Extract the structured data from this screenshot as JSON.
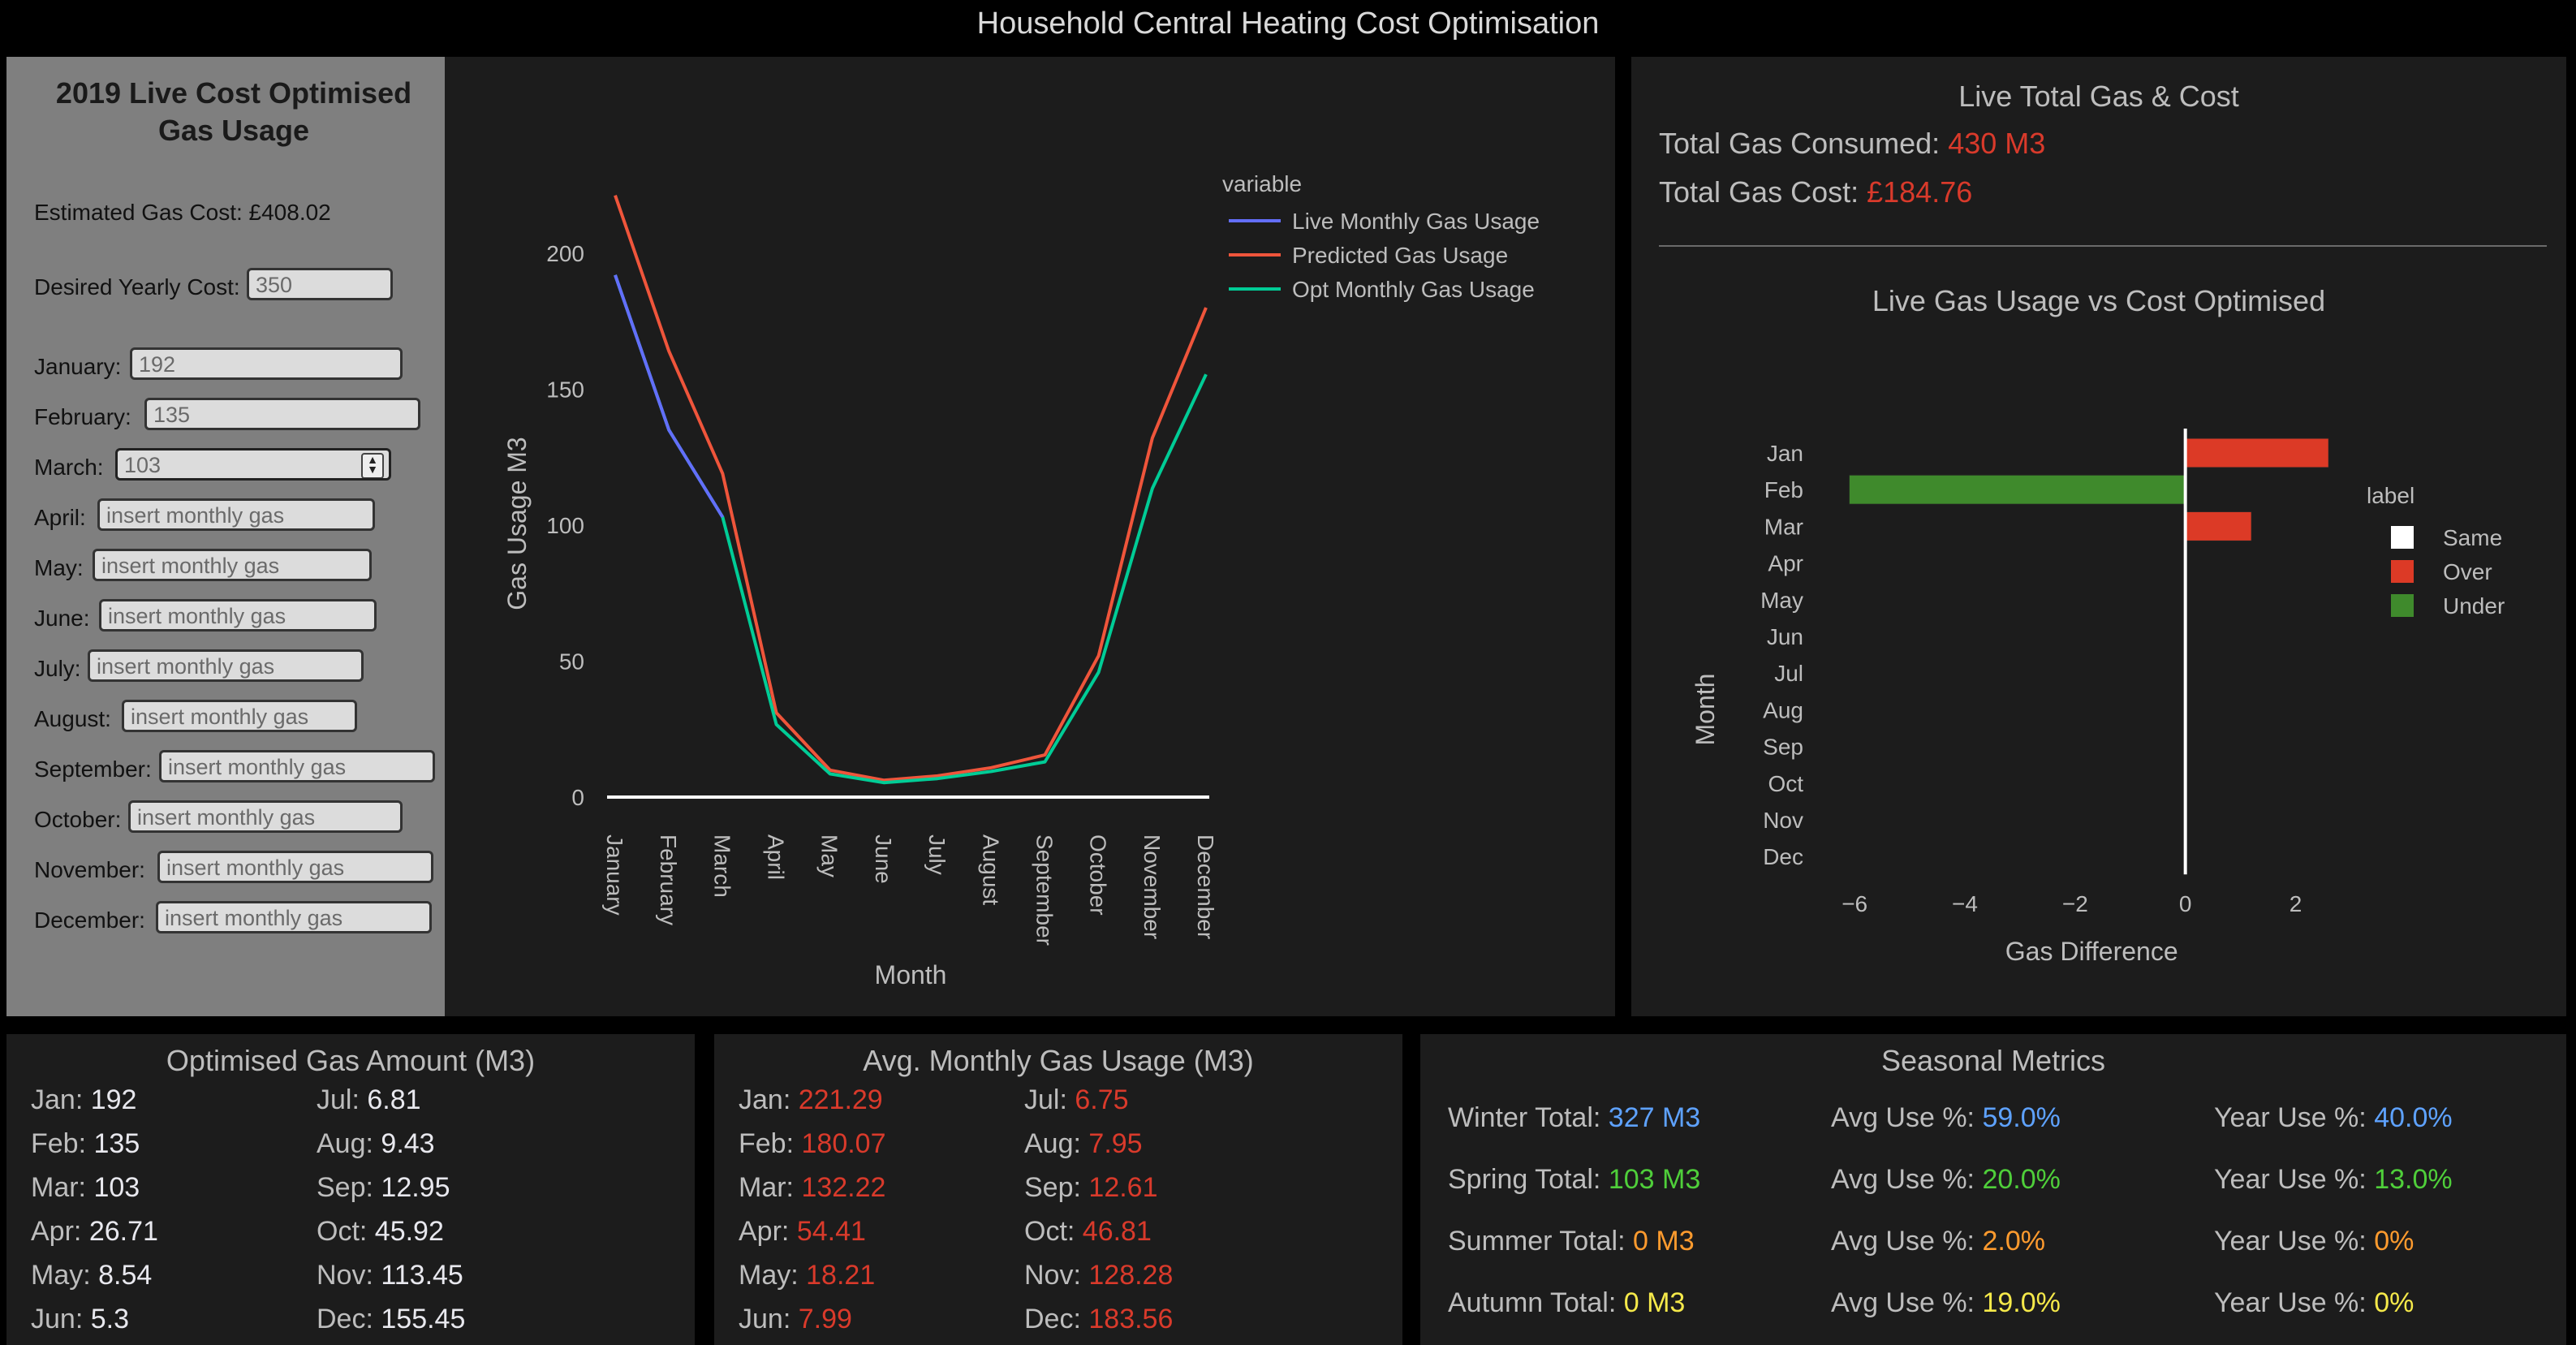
{
  "header": {
    "title": "Household Central Heating Cost Optimisation"
  },
  "sidebar": {
    "title": "2019 Live Cost Optimised Gas Usage",
    "estimated_cost": "Estimated Gas Cost: £408.02",
    "desired_label": "Desired Yearly Cost:",
    "desired_value": "350",
    "months": [
      {
        "label": "January:",
        "value": "192",
        "placeholder": ""
      },
      {
        "label": "February:",
        "value": "135",
        "placeholder": ""
      },
      {
        "label": "March:",
        "value": "103",
        "placeholder": ""
      },
      {
        "label": "April:",
        "value": "",
        "placeholder": "insert monthly gas"
      },
      {
        "label": "May:",
        "value": "",
        "placeholder": "insert monthly gas"
      },
      {
        "label": "June:",
        "value": "",
        "placeholder": "insert monthly gas"
      },
      {
        "label": "July:",
        "value": "",
        "placeholder": "insert monthly gas"
      },
      {
        "label": "August:",
        "value": "",
        "placeholder": "insert monthly gas"
      },
      {
        "label": "September:",
        "value": "",
        "placeholder": "insert monthly gas"
      },
      {
        "label": "October:",
        "value": "",
        "placeholder": "insert monthly gas"
      },
      {
        "label": "November:",
        "value": "",
        "placeholder": "insert monthly gas"
      },
      {
        "label": "December:",
        "value": "",
        "placeholder": "insert monthly gas"
      }
    ]
  },
  "totals": {
    "title": "Live Total Gas & Cost",
    "gas_label": "Total Gas Consumed:",
    "gas_value": "430 M3",
    "cost_label": "Total Gas Cost:",
    "cost_value": "£184.76"
  },
  "chart_data": [
    {
      "type": "line",
      "xlabel": "Month",
      "ylabel": "Gas Usage M3",
      "legend_title": "variable",
      "legend_position": "top-right",
      "ylim": [
        0,
        225
      ],
      "yticks": [
        0,
        50,
        100,
        150,
        200
      ],
      "categories": [
        "January",
        "February",
        "March",
        "April",
        "May",
        "June",
        "July",
        "August",
        "September",
        "October",
        "November",
        "December"
      ],
      "series": [
        {
          "name": "Live Monthly Gas Usage",
          "color": "#636efa",
          "values": [
            192,
            135,
            103
          ]
        },
        {
          "name": "Predicted Gas Usage",
          "color": "#ef553b",
          "values": [
            221.29,
            164,
            119,
            31,
            9.9,
            6.2,
            7.8,
            10.8,
            15.5,
            52,
            132,
            180
          ]
        },
        {
          "name": "Opt Monthly Gas Usage",
          "color": "#00cc96",
          "values": [
            192,
            135,
            103,
            26.71,
            8.54,
            5.3,
            6.81,
            9.43,
            12.95,
            45.92,
            113.45,
            155.45
          ]
        }
      ]
    },
    {
      "type": "bar",
      "orientation": "horizontal",
      "title": "Live Gas Usage vs Cost Optimised",
      "xlabel": "Gas Difference",
      "ylabel": "Month",
      "legend_title": "label",
      "legend_position": "right",
      "xlim": [
        -6.4,
        3.2
      ],
      "xticks": [
        -6,
        -4,
        -2,
        0,
        2
      ],
      "categories": [
        "Jan",
        "Feb",
        "Mar",
        "Apr",
        "May",
        "Jun",
        "Jul",
        "Aug",
        "Sep",
        "Oct",
        "Nov",
        "Dec"
      ],
      "values": [
        2.6,
        -6.1,
        1.2,
        0,
        0,
        0,
        0,
        0,
        0,
        0,
        0,
        0
      ],
      "labels": [
        "Over",
        "Under",
        "Over",
        "Same",
        "Same",
        "Same",
        "Same",
        "Same",
        "Same",
        "Same",
        "Same",
        "Same"
      ],
      "legend": [
        {
          "name": "Same",
          "color": "#ffffff"
        },
        {
          "name": "Over",
          "color": "#dc3a26"
        },
        {
          "name": "Under",
          "color": "#3f8a2c"
        }
      ]
    }
  ],
  "optimised": {
    "title": "Optimised Gas Amount (M3)",
    "items": [
      {
        "k": "Jan:",
        "v": "192"
      },
      {
        "k": "Feb:",
        "v": "135"
      },
      {
        "k": "Mar:",
        "v": "103"
      },
      {
        "k": "Apr:",
        "v": "26.71"
      },
      {
        "k": "May:",
        "v": "8.54"
      },
      {
        "k": "Jun:",
        "v": "5.3"
      },
      {
        "k": "Jul:",
        "v": "6.81"
      },
      {
        "k": "Aug:",
        "v": "9.43"
      },
      {
        "k": "Sep:",
        "v": "12.95"
      },
      {
        "k": "Oct:",
        "v": "45.92"
      },
      {
        "k": "Nov:",
        "v": "113.45"
      },
      {
        "k": "Dec:",
        "v": "155.45"
      }
    ]
  },
  "average": {
    "title": "Avg. Monthly Gas Usage (M3)",
    "items": [
      {
        "k": "Jan:",
        "v": "221.29"
      },
      {
        "k": "Feb:",
        "v": "180.07"
      },
      {
        "k": "Mar:",
        "v": "132.22"
      },
      {
        "k": "Apr:",
        "v": "54.41"
      },
      {
        "k": "May:",
        "v": "18.21"
      },
      {
        "k": "Jun:",
        "v": "7.99"
      },
      {
        "k": "Jul:",
        "v": "6.75"
      },
      {
        "k": "Aug:",
        "v": "7.95"
      },
      {
        "k": "Sep:",
        "v": "12.61"
      },
      {
        "k": "Oct:",
        "v": "46.81"
      },
      {
        "k": "Nov:",
        "v": "128.28"
      },
      {
        "k": "Dec:",
        "v": "183.56"
      }
    ]
  },
  "seasonal": {
    "title": "Seasonal Metrics",
    "rows": [
      {
        "total_label": "Winter Total:",
        "total": "327 M3",
        "avg_label": "Avg Use %:",
        "avg": "59.0%",
        "year_label": "Year Use %:",
        "year": "40.0%",
        "color": "lblue"
      },
      {
        "total_label": "Spring Total:",
        "total": "103 M3",
        "avg_label": "Avg Use %:",
        "avg": "20.0%",
        "year_label": "Year Use %:",
        "year": "13.0%",
        "color": "green"
      },
      {
        "total_label": "Summer Total:",
        "total": "0 M3",
        "avg_label": "Avg Use %:",
        "avg": "2.0%",
        "year_label": "Year Use %:",
        "year": "0%",
        "color": "orange"
      },
      {
        "total_label": "Autumn Total:",
        "total": "0 M3",
        "avg_label": "Avg Use %:",
        "avg": "19.0%",
        "year_label": "Year Use %:",
        "year": "0%",
        "color": "yellow"
      }
    ]
  }
}
